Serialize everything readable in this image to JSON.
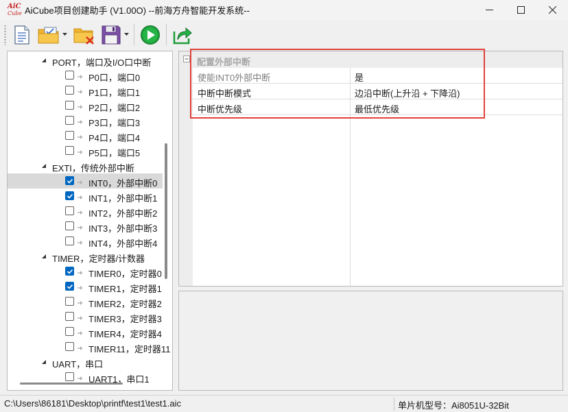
{
  "window": {
    "title": "AiCube项目创建助手 (V1.00O) --前海方舟智能开发系统--",
    "logo_top": "AiC",
    "logo_bottom": "Cube"
  },
  "toolbar": {
    "icons": [
      "new-document-icon",
      "open-folder-check-icon",
      "close-folder-icon",
      "save-disk-icon",
      "run-play-icon",
      "export-icon"
    ],
    "colors": {
      "play": "#1e9e3a",
      "folder": "#f2b531",
      "save": "#7b4fa6",
      "delete": "#d93025"
    }
  },
  "tree": {
    "rows": [
      {
        "label": "PORT，端口及I/O口中断",
        "group": true,
        "expanded": true
      },
      {
        "label": "P0口，端口0",
        "checked": false
      },
      {
        "label": "P1口，端口1",
        "checked": false
      },
      {
        "label": "P2口，端口2",
        "checked": false
      },
      {
        "label": "P3口，端口3",
        "checked": false
      },
      {
        "label": "P4口，端口4",
        "checked": false
      },
      {
        "label": "P5口，端口5",
        "checked": false
      },
      {
        "label": "EXTI，传统外部中断",
        "group": true,
        "expanded": true
      },
      {
        "label": "INT0，外部中断0",
        "checked": true,
        "selected": true
      },
      {
        "label": "INT1，外部中断1",
        "checked": true
      },
      {
        "label": "INT2，外部中断2",
        "checked": false
      },
      {
        "label": "INT3，外部中断3",
        "checked": false
      },
      {
        "label": "INT4，外部中断4",
        "checked": false
      },
      {
        "label": "TIMER，定时器/计数器",
        "group": true,
        "expanded": true
      },
      {
        "label": "TIMER0，定时器0",
        "checked": true
      },
      {
        "label": "TIMER1，定时器1",
        "checked": true
      },
      {
        "label": "TIMER2，定时器2",
        "checked": false
      },
      {
        "label": "TIMER3，定时器3",
        "checked": false
      },
      {
        "label": "TIMER4，定时器4",
        "checked": false
      },
      {
        "label": "TIMER11，定时器11",
        "checked": false
      },
      {
        "label": "UART，串口",
        "group": true,
        "expanded": true
      },
      {
        "label": "UART1，串口1",
        "checked": false
      }
    ]
  },
  "properties": {
    "category": "配置外部中断",
    "rows": [
      {
        "name": "使能INT0外部中断",
        "value": "是",
        "dim": true
      },
      {
        "name": "中断中断模式",
        "value": "边沿中断(上升沿 + 下降沿)",
        "dim": false
      },
      {
        "name": "中断优先级",
        "value": "最低优先级",
        "dim": false
      }
    ],
    "highlight_color": "#e0413a"
  },
  "status": {
    "path": "C:\\Users\\86181\\Desktop\\printf\\test1\\test1.aic",
    "model": "单片机型号：Ai8051U-32Bit"
  }
}
